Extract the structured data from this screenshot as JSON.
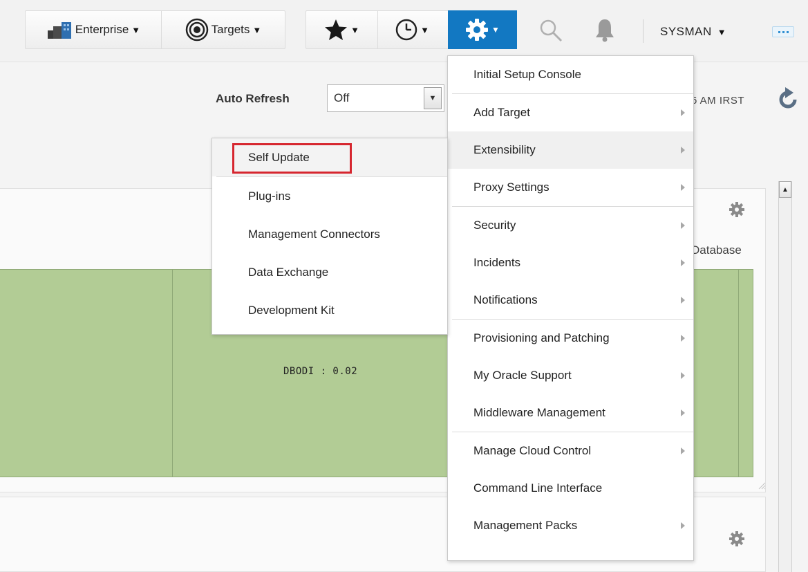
{
  "toolbar": {
    "enterprise_label": "Enterprise",
    "targets_label": "Targets",
    "user_label": "SYSMAN"
  },
  "icons": {
    "enterprise": "enterprise-icon",
    "targets": "target-icon",
    "favorites": "star-icon",
    "history": "clock-icon",
    "setup": "gear-icon",
    "search": "search-icon",
    "notifications": "bell-icon",
    "more": "more-icon"
  },
  "colors": {
    "setup_active": "#1278c2",
    "treemap_fill": "#b2cc95",
    "highlight_box": "#d6262f"
  },
  "refresh": {
    "label": "Auto Refresh",
    "value": "Off",
    "last_refresh_time": "6 AM IRST"
  },
  "dashboard": {
    "column_label": "Database",
    "treemap_label": "DBODI : 0.02"
  },
  "setup_menu": {
    "items": [
      {
        "label": "Initial Setup Console"
      },
      {
        "label": "Add Target"
      },
      {
        "label": "Extensibility"
      },
      {
        "label": "Proxy Settings"
      },
      {
        "label": "Security"
      },
      {
        "label": "Incidents"
      },
      {
        "label": "Notifications"
      },
      {
        "label": "Provisioning and Patching"
      },
      {
        "label": "My Oracle Support"
      },
      {
        "label": "Middleware Management"
      },
      {
        "label": "Manage Cloud Control"
      },
      {
        "label": "Command Line Interface"
      },
      {
        "label": "Management Packs"
      }
    ]
  },
  "extensibility_menu": {
    "items": [
      {
        "label": "Self Update"
      },
      {
        "label": "Plug-ins"
      },
      {
        "label": "Management Connectors"
      },
      {
        "label": "Data Exchange"
      },
      {
        "label": "Development Kit"
      }
    ]
  }
}
